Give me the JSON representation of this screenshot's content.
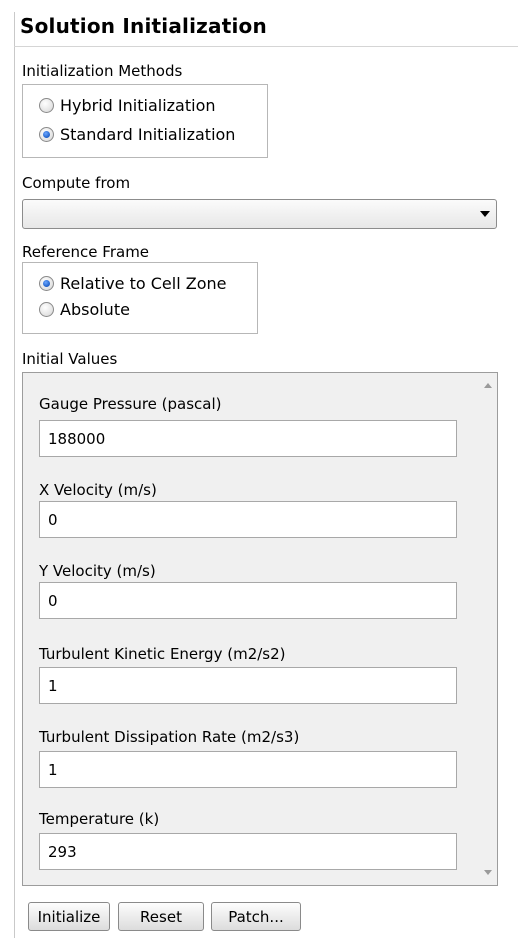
{
  "panel": {
    "title": "Solution Initialization"
  },
  "init_methods": {
    "label": "Initialization Methods",
    "options": [
      {
        "label": "Hybrid  Initialization",
        "selected": false
      },
      {
        "label": "Standard Initialization",
        "selected": true
      }
    ]
  },
  "compute_from": {
    "label": "Compute from",
    "value": ""
  },
  "reference_frame": {
    "label": "Reference Frame",
    "options": [
      {
        "label": "Relative to Cell Zone",
        "selected": true
      },
      {
        "label": "Absolute",
        "selected": false
      }
    ]
  },
  "initial_values": {
    "label": "Initial Values",
    "fields": [
      {
        "label": "Gauge Pressure (pascal)",
        "value": "188000"
      },
      {
        "label": "X Velocity (m/s)",
        "value": "0"
      },
      {
        "label": "Y Velocity (m/s)",
        "value": "0"
      },
      {
        "label": "Turbulent Kinetic Energy (m2/s2)",
        "value": "1"
      },
      {
        "label": "Turbulent Dissipation Rate (m2/s3)",
        "value": "1"
      },
      {
        "label": "Temperature (k)",
        "value": "293"
      }
    ]
  },
  "buttons": {
    "initialize": "Initialize",
    "reset": "Reset",
    "patch": "Patch..."
  }
}
